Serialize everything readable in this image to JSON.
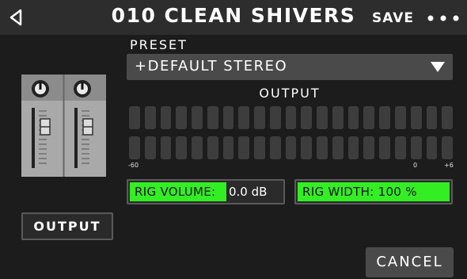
{
  "header": {
    "title": "010 CLEAN SHIVERS",
    "save_label": "SAVE",
    "back_icon": "back-triangle-icon",
    "more_icon": "more-dots-icon"
  },
  "preset": {
    "label": "PRESET",
    "value": "+DEFAULT STEREO",
    "arrow_icon": "dropdown-arrow-icon"
  },
  "output_meter": {
    "label": "OUTPUT",
    "scale_min": "-60",
    "scale_zero": "0",
    "scale_max": "+6",
    "level": 0
  },
  "rig_volume": {
    "label": "RIG VOLUME:",
    "value": "0.0 dB",
    "fill_color": "#33ee22"
  },
  "rig_width": {
    "label": "RIG WIDTH: 100 %",
    "level": 1.0,
    "fill_color": "#33ee22"
  },
  "buttons": {
    "output": "OUTPUT",
    "cancel": "CANCEL"
  },
  "mixer_icon": "stereo-mixer-icon"
}
